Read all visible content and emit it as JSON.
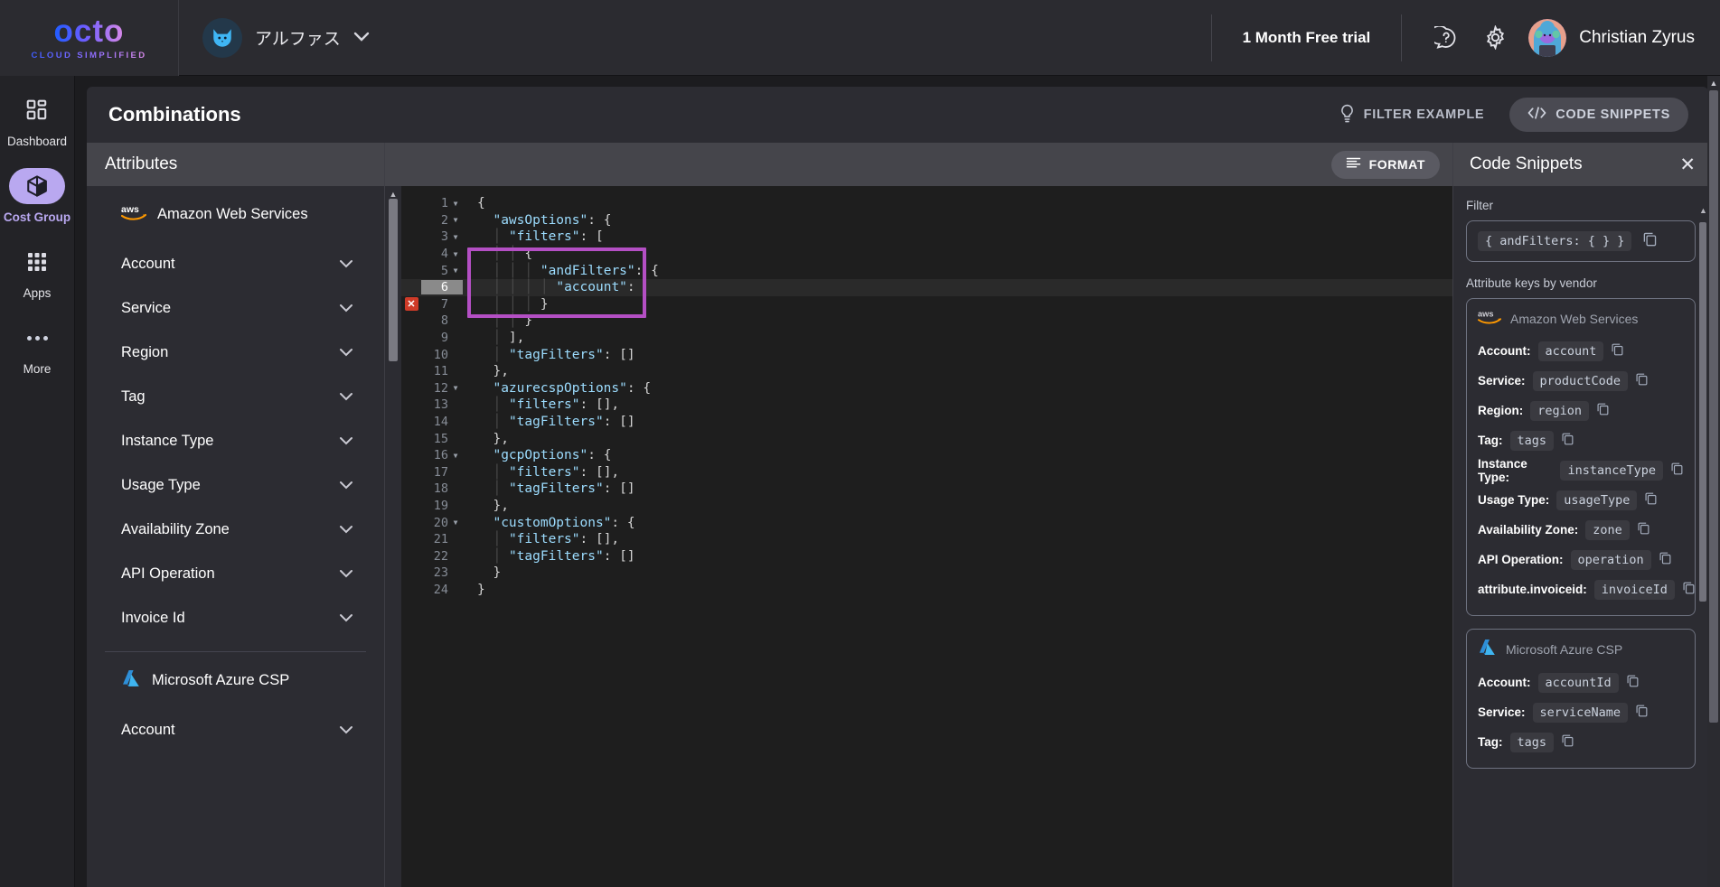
{
  "topbar": {
    "logo_word": "octo",
    "logo_tagline": "CLOUD SIMPLIFIED",
    "org_name": "アルファス",
    "org_avatar_icon": "cat-icon",
    "org_chevron_icon": "chevron-down-icon",
    "trial_label": "1 Month Free trial",
    "help_icon": "help-icon",
    "settings_icon": "gear-icon",
    "user_name": "Christian Zyrus",
    "user_avatar_icon": "avatar-icon"
  },
  "sidebar": {
    "items": [
      {
        "label": "Dashboard",
        "icon": "dashboard-grid-icon",
        "active": false
      },
      {
        "label": "Cost Group",
        "icon": "cube-box-icon",
        "active": true
      },
      {
        "label": "Apps",
        "icon": "apps-grid-icon",
        "active": false
      },
      {
        "label": "More",
        "icon": "more-dots-icon",
        "active": false
      }
    ]
  },
  "card": {
    "title": "Combinations",
    "filter_example_label": "FILTER EXAMPLE",
    "filter_example_icon": "lightbulb-icon",
    "code_snippets_label": "CODE SNIPPETS",
    "code_snippets_icon": "code-brackets-icon"
  },
  "attributes_panel": {
    "title": "Attributes",
    "vendors": [
      {
        "name": "Amazon Web Services",
        "icon": "aws-icon",
        "attributes": [
          "Account",
          "Service",
          "Region",
          "Tag",
          "Instance Type",
          "Usage Type",
          "Availability Zone",
          "API Operation",
          "Invoice Id"
        ]
      },
      {
        "name": "Microsoft Azure CSP",
        "icon": "azure-icon",
        "attributes": [
          "Account"
        ]
      }
    ],
    "row_chevron_icon": "chevron-down-icon"
  },
  "editor": {
    "format_label": "FORMAT",
    "format_icon": "format-lines-icon",
    "active_line": 6,
    "error_line": 7,
    "error_marker_icon": "error-x-icon",
    "highlight_color": "#b44fc4",
    "lines": [
      {
        "n": 1,
        "fold": true,
        "indent": 0,
        "text": "{"
      },
      {
        "n": 2,
        "fold": true,
        "indent": 1,
        "text": "\"awsOptions\": {"
      },
      {
        "n": 3,
        "fold": true,
        "indent": 2,
        "text": "\"filters\": ["
      },
      {
        "n": 4,
        "fold": true,
        "indent": 3,
        "text": "{"
      },
      {
        "n": 5,
        "fold": true,
        "indent": 4,
        "text": "\"andFilters\": {"
      },
      {
        "n": 6,
        "fold": false,
        "indent": 5,
        "text": "\"account\":"
      },
      {
        "n": 7,
        "fold": false,
        "indent": 4,
        "text": "}"
      },
      {
        "n": 8,
        "fold": false,
        "indent": 3,
        "text": "}"
      },
      {
        "n": 9,
        "fold": false,
        "indent": 2,
        "text": "],"
      },
      {
        "n": 10,
        "fold": false,
        "indent": 2,
        "text": "\"tagFilters\": []"
      },
      {
        "n": 11,
        "fold": false,
        "indent": 1,
        "text": "},"
      },
      {
        "n": 12,
        "fold": true,
        "indent": 1,
        "text": "\"azurecspOptions\": {"
      },
      {
        "n": 13,
        "fold": false,
        "indent": 2,
        "text": "\"filters\": [],"
      },
      {
        "n": 14,
        "fold": false,
        "indent": 2,
        "text": "\"tagFilters\": []"
      },
      {
        "n": 15,
        "fold": false,
        "indent": 1,
        "text": "},"
      },
      {
        "n": 16,
        "fold": true,
        "indent": 1,
        "text": "\"gcpOptions\": {"
      },
      {
        "n": 17,
        "fold": false,
        "indent": 2,
        "text": "\"filters\": [],"
      },
      {
        "n": 18,
        "fold": false,
        "indent": 2,
        "text": "\"tagFilters\": []"
      },
      {
        "n": 19,
        "fold": false,
        "indent": 1,
        "text": "},"
      },
      {
        "n": 20,
        "fold": true,
        "indent": 1,
        "text": "\"customOptions\": {"
      },
      {
        "n": 21,
        "fold": false,
        "indent": 2,
        "text": "\"filters\": [],"
      },
      {
        "n": 22,
        "fold": false,
        "indent": 2,
        "text": "\"tagFilters\": []"
      },
      {
        "n": 23,
        "fold": false,
        "indent": 1,
        "text": "}"
      },
      {
        "n": 24,
        "fold": false,
        "indent": 0,
        "text": "}"
      }
    ]
  },
  "snippets": {
    "title": "Code Snippets",
    "close_icon": "close-icon",
    "filter_label": "Filter",
    "filter_snippet": "{ andFilters: { } }",
    "copy_icon": "copy-icon",
    "vendor_keys_label": "Attribute keys by vendor",
    "vendors": [
      {
        "name": "Amazon Web Services",
        "icon": "aws-icon",
        "keys": [
          {
            "label": "Account:",
            "value": "account"
          },
          {
            "label": "Service:",
            "value": "productCode"
          },
          {
            "label": "Region:",
            "value": "region"
          },
          {
            "label": "Tag:",
            "value": "tags"
          },
          {
            "label": "Instance Type:",
            "value": "instanceType"
          },
          {
            "label": "Usage Type:",
            "value": "usageType"
          },
          {
            "label": "Availability Zone:",
            "value": "zone"
          },
          {
            "label": "API Operation:",
            "value": "operation"
          },
          {
            "label": "attribute.invoiceid:",
            "value": "invoiceId"
          }
        ]
      },
      {
        "name": "Microsoft Azure CSP",
        "icon": "azure-icon",
        "keys": [
          {
            "label": "Account:",
            "value": "accountId"
          },
          {
            "label": "Service:",
            "value": "serviceName"
          },
          {
            "label": "Tag:",
            "value": "tags"
          }
        ]
      }
    ]
  }
}
